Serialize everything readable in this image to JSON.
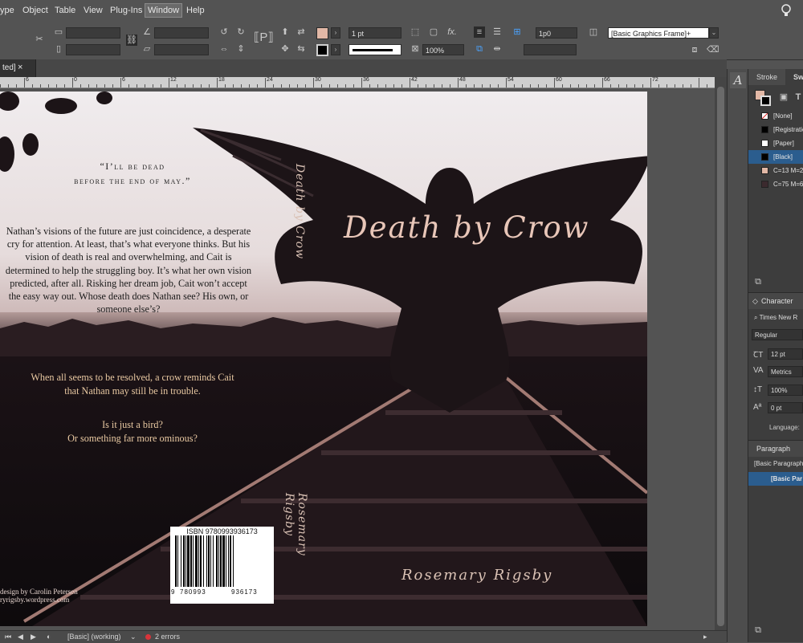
{
  "menubar": {
    "items": [
      {
        "label": "ype"
      },
      {
        "label": "Object"
      },
      {
        "label": "Table"
      },
      {
        "label": "View"
      },
      {
        "label": "Plug-Ins"
      },
      {
        "label": "Window"
      },
      {
        "label": "Help"
      }
    ]
  },
  "control": {
    "stroke_weight": "1 pt",
    "zoom_percent": "100%",
    "offset": "1p0",
    "object_style": "[Basic Graphics Frame]+",
    "fill_color": "#e2b8a6",
    "stroke_color": "#000000",
    "fx_label": "fx."
  },
  "document_tab": {
    "label": "ted]",
    "close": "×"
  },
  "ruler": {
    "labels": [
      "6",
      "0",
      "6",
      "12",
      "18",
      "24",
      "30",
      "36",
      "42",
      "48",
      "54",
      "60",
      "66",
      "72"
    ]
  },
  "page": {
    "quote_line1": "“I’ll be dead",
    "quote_line2": "before the end of may.”",
    "blurb": "Nathan’s visions of the future are just coincidence, a desperate cry for attention. At least, that’s what everyone thinks. But his vision of death is real and overwhelming, and Cait is determined to help the struggling boy. It’s what her own vision predicted, after all. Risking her dream job, Cait won’t accept the easy way out. Whose death does Nathan see? His own, or someone else’s?",
    "tease1_line1": "When all seems to be resolved, a crow reminds Cait",
    "tease1_line2": "that Nathan may still be in trouble.",
    "tease2_line1": "Is it just a bird?",
    "tease2_line2": "Or something far more ominous?",
    "spine_title": "Death by Crow",
    "spine_author": "Rosemary Rigsby",
    "cover_title": "Death by Crow",
    "cover_author": "Rosemary Rigsby",
    "credit_line1": "design by Carolin Petersen",
    "credit_line2": "ryrigsby.wordpress.com",
    "barcode": {
      "isbn": "ISBN 9780993936173",
      "left": "9",
      "middle": "780993",
      "right": "936173"
    }
  },
  "statusbar": {
    "style": "[Basic] (working)",
    "errors": "2 errors"
  },
  "panels": {
    "tabs": [
      "Stroke",
      "Sw"
    ],
    "swatches": [
      {
        "name": "[None]",
        "color": "#ffffff"
      },
      {
        "name": "[Registratio",
        "color": "#000000"
      },
      {
        "name": "[Paper]",
        "color": "#ffffff"
      },
      {
        "name": "[Black]",
        "color": "#000000",
        "selected": true
      },
      {
        "name": "C=13 M=2",
        "color": "#e2b8a6"
      },
      {
        "name": "C=75 M=6",
        "color": "#3b2a2e"
      }
    ],
    "character": {
      "title": "Character",
      "font": "Times New R",
      "style": "Regular",
      "size": "12 pt",
      "kerning": "Metrics",
      "vscale": "100%",
      "baseline": "0 pt",
      "language_label": "Language:"
    },
    "paragraph": {
      "title": "Paragraph",
      "style1": "[Basic Paragraph]",
      "style2": "[Basic Par"
    }
  }
}
